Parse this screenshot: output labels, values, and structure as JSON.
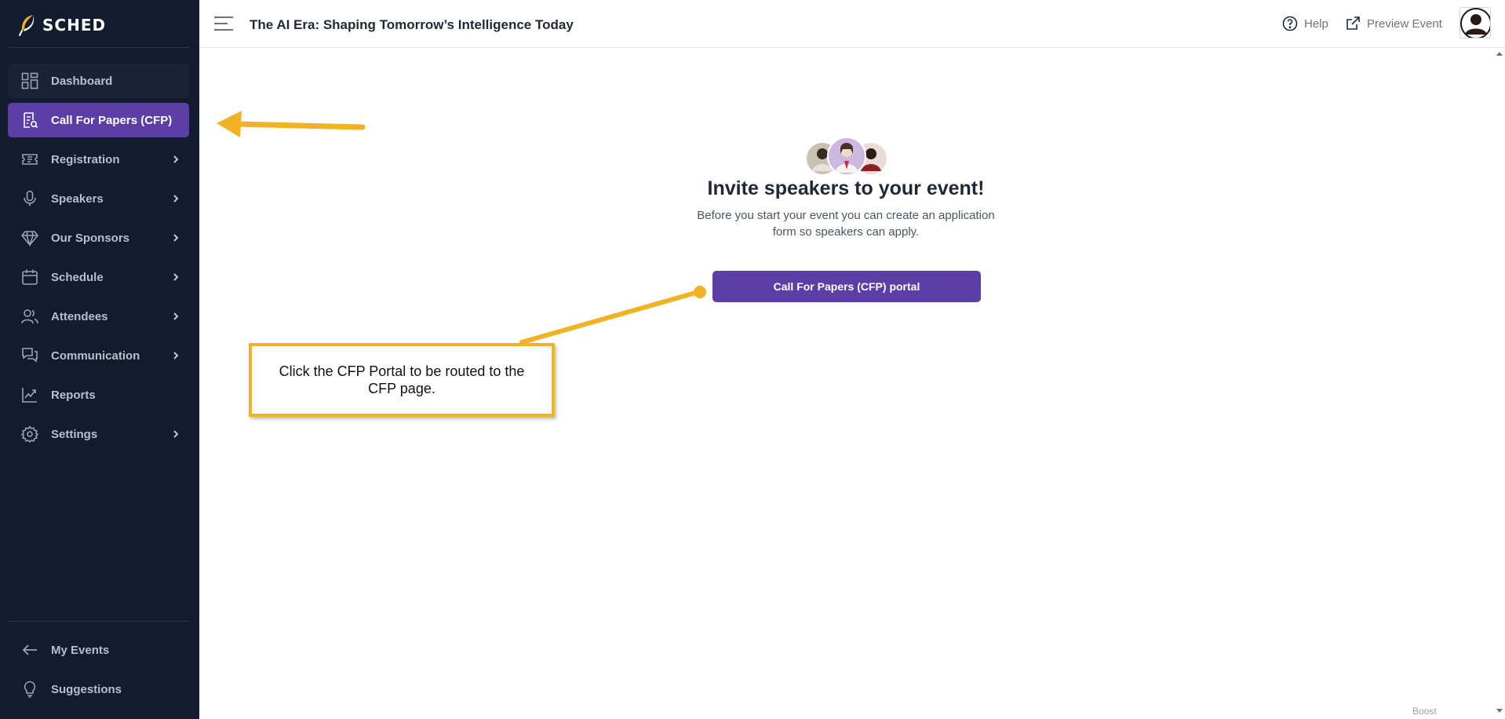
{
  "app": {
    "logo_text": "SCHED",
    "logo_icon": "feather-icon"
  },
  "sidebar": {
    "items": [
      {
        "label": "Dashboard",
        "icon": "dashboard-icon",
        "has_submenu": false,
        "state": "hover"
      },
      {
        "label": "Call For Papers (CFP)",
        "icon": "cfp-document-icon",
        "has_submenu": false,
        "state": "active"
      },
      {
        "label": "Registration",
        "icon": "ticket-icon",
        "has_submenu": true
      },
      {
        "label": "Speakers",
        "icon": "microphone-icon",
        "has_submenu": true
      },
      {
        "label": "Our Sponsors",
        "icon": "diamond-icon",
        "has_submenu": true
      },
      {
        "label": "Schedule",
        "icon": "calendar-icon",
        "has_submenu": true
      },
      {
        "label": "Attendees",
        "icon": "users-icon",
        "has_submenu": true
      },
      {
        "label": "Communication",
        "icon": "chat-icon",
        "has_submenu": true
      },
      {
        "label": "Reports",
        "icon": "chart-line-icon",
        "has_submenu": false
      },
      {
        "label": "Settings",
        "icon": "gear-icon",
        "has_submenu": true
      }
    ],
    "footer_items": [
      {
        "label": "My Events",
        "icon": "arrow-left-icon"
      },
      {
        "label": "Suggestions",
        "icon": "lightbulb-icon"
      }
    ]
  },
  "header": {
    "event_title": "The AI Era: Shaping Tomorrow’s Intelligence Today",
    "help_label": "Help",
    "preview_label": "Preview Event"
  },
  "main": {
    "headline": "Invite speakers to your event!",
    "subtext": "Before you start your event you can create an application form so speakers can apply.",
    "button_label": "Call For Papers (CFP) portal"
  },
  "annotation": {
    "callout_text": "Click the CFP Portal to be routed to the CFP page."
  },
  "footer": {
    "boost_label": "Boost"
  },
  "colors": {
    "sidebar_bg": "#131b2e",
    "accent_purple": "#5b3fa6",
    "annotation_yellow": "#f0b323"
  }
}
